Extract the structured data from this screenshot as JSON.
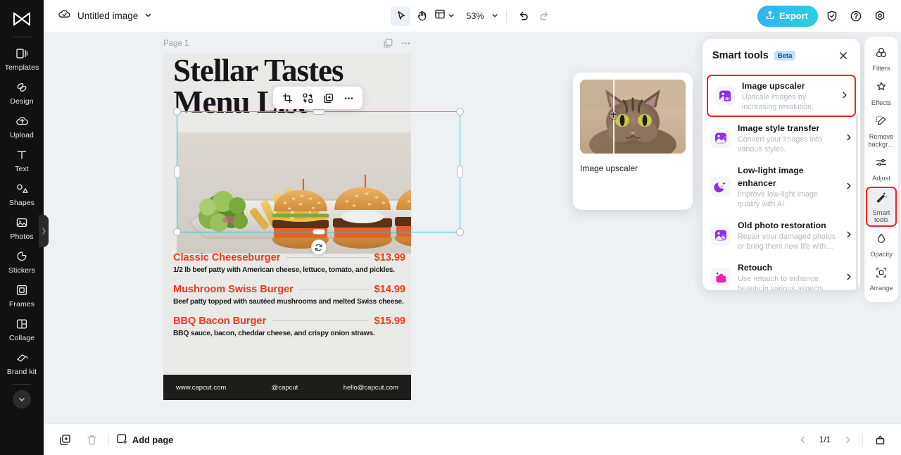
{
  "app": {
    "name": "CapCut Image Editor"
  },
  "left_rail": {
    "logo_icon": "capcut-logo-icon",
    "items": [
      {
        "label": "Templates",
        "icon": "templates-icon"
      },
      {
        "label": "Design",
        "icon": "design-icon"
      },
      {
        "label": "Upload",
        "icon": "upload-cloud-icon"
      },
      {
        "label": "Text",
        "icon": "text-icon"
      },
      {
        "label": "Shapes",
        "icon": "shapes-icon"
      },
      {
        "label": "Photos",
        "icon": "photos-icon"
      },
      {
        "label": "Stickers",
        "icon": "stickers-icon"
      },
      {
        "label": "Frames",
        "icon": "frames-icon"
      },
      {
        "label": "Collage",
        "icon": "collage-icon"
      },
      {
        "label": "Brand kit",
        "icon": "brand-kit-icon"
      }
    ],
    "expand_icon": "chevron-down-icon",
    "collapse_handle_icon": "chevron-right-icon"
  },
  "topbar": {
    "cloud_icon": "cloud-saved-icon",
    "doc_title": "Untitled image",
    "title_chevron_icon": "chevron-down-icon",
    "tools": {
      "select_icon": "cursor-select-icon",
      "hand_icon": "hand-pan-icon",
      "layout_icon": "layout-grid-icon",
      "layout_chevron_icon": "chevron-down-icon",
      "zoom_level": "53%",
      "zoom_chevron_icon": "chevron-down-icon",
      "undo_icon": "undo-icon",
      "redo_icon": "redo-icon"
    },
    "export_label": "Export",
    "export_icon": "export-upload-icon",
    "export_color": "#2fb3f5",
    "shield_icon": "shield-check-icon",
    "help_icon": "help-circle-icon",
    "settings_icon": "settings-gear-icon"
  },
  "workspace": {
    "page_label": "Page 1",
    "duplicate_page_icon": "duplicate-page-icon",
    "more_icon": "more-horizontal-icon",
    "background_color": "#eef1f4"
  },
  "canvas": {
    "title_line1": "Stellar Tastes",
    "title_line2": "Menu List",
    "accent_color": "#ee3a17",
    "background_color": "#e9e9e7",
    "menu_items": [
      {
        "name": "Classic Cheeseburger",
        "price": "$13.99",
        "description": "1/2 lb beef patty with American cheese, lettuce, tomato, and pickles."
      },
      {
        "name": "Mushroom Swiss Burger",
        "price": "$14.99",
        "description": "Beef patty topped with sautéed mushrooms and melted Swiss cheese."
      },
      {
        "name": "BBQ Bacon Burger",
        "price": "$15.99",
        "description": "BBQ sauce, bacon, cheddar cheese, and crispy onion straws."
      }
    ],
    "footer": {
      "website": "www.capcut.com",
      "handle": "@capcut",
      "email": "hello@capcut.com"
    }
  },
  "float_toolbar": {
    "crop_icon": "crop-icon",
    "replace_icon": "replace-shuffle-icon",
    "duplicate_icon": "duplicate-icon",
    "more_icon": "more-horizontal-icon"
  },
  "selection": {
    "handle_color": "#1ec2e0",
    "rotate_icon": "rotate-icon"
  },
  "preview_card": {
    "label": "Image upscaler",
    "thumbnail_alt": "cat-before-after-thumbnail",
    "split_icon": "split-compare-icon"
  },
  "smart_tools": {
    "title": "Smart tools",
    "badge": "Beta",
    "badge_color": "#bfe0fb",
    "close_icon": "close-icon",
    "selected_index": 0,
    "highlight_color": "#f5231f",
    "items": [
      {
        "name": "Image upscaler",
        "description": "Upscale images by increasing resolution.",
        "icon": "image-upscaler-4k-icon",
        "icon_color": "#8b2fe8",
        "arrow_icon": "chevron-right-icon"
      },
      {
        "name": "Image style transfer",
        "description": "Convert your images into various styles.",
        "icon": "style-transfer-icon",
        "icon_color": "#8b2fe8",
        "arrow_icon": "chevron-right-icon"
      },
      {
        "name": "Low-light image enhancer",
        "description": "Improve low-light image quality with AI.",
        "icon": "moon-sparkle-icon",
        "icon_color": "#8b2fe8",
        "arrow_icon": "chevron-right-icon"
      },
      {
        "name": "Old photo restoration",
        "description": "Repair your damaged photos or bring them new life with…",
        "icon": "photo-restore-icon",
        "icon_color": "#8b2fe8",
        "arrow_icon": "chevron-right-icon"
      },
      {
        "name": "Retouch",
        "description": "Use retouch to enhance beauty in various aspects.",
        "icon": "retouch-icon",
        "icon_color": "#f020b0",
        "arrow_icon": "chevron-right-icon"
      }
    ]
  },
  "right_rail": {
    "selected_index": 4,
    "highlight_color": "#f5231f",
    "items": [
      {
        "label": "Filters",
        "icon": "filters-icon"
      },
      {
        "label": "Effects",
        "icon": "effects-icon"
      },
      {
        "label": "Remove backgr…",
        "icon": "remove-background-icon"
      },
      {
        "label": "Adjust",
        "icon": "adjust-sliders-icon"
      },
      {
        "label": "Smart tools",
        "icon": "smart-tools-wand-icon"
      },
      {
        "label": "Opacity",
        "icon": "opacity-drop-icon"
      },
      {
        "label": "Arrange",
        "icon": "arrange-icon"
      }
    ]
  },
  "bottombar": {
    "duplicate_icon": "duplicate-page-icon",
    "delete_icon": "trash-icon",
    "add_page_label": "Add page",
    "add_page_icon": "add-page-icon",
    "prev_icon": "chevron-left-icon",
    "next_icon": "chevron-right-icon",
    "page_indicator": "1/1",
    "pages_panel_icon": "pages-panel-icon"
  }
}
